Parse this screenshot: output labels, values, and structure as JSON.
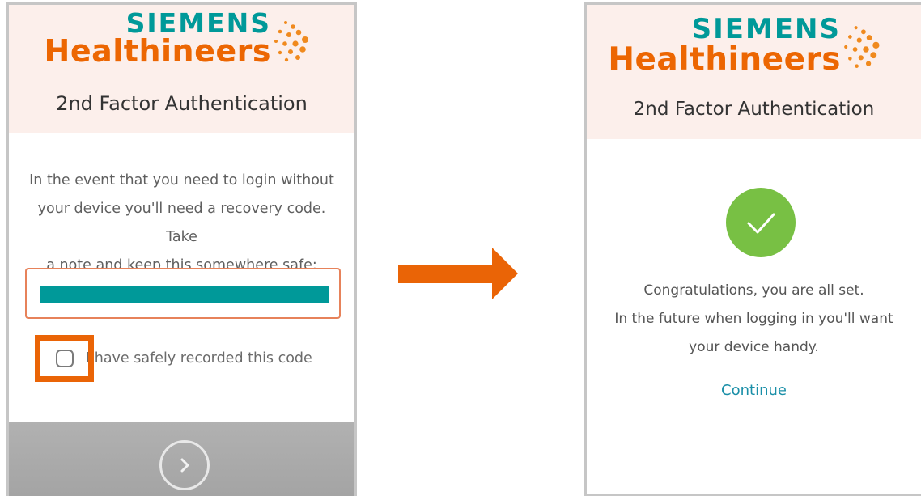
{
  "brand": {
    "line1": "SIEMENS",
    "line2": "Healthineers",
    "colors": {
      "teal": "#009999",
      "orange": "#ec6602",
      "dots": "#f08a1e"
    }
  },
  "left_screen": {
    "header_title": "2nd Factor Authentication",
    "instructions": [
      "In the event that you need to login without",
      "your device you'll need a recovery code. Take",
      "a note and keep this somewhere safe:"
    ],
    "recovery_code_redacted": true,
    "checkbox_label": "I have safely recorded this code",
    "checkbox_checked": false,
    "next_icon": "chevron-right-icon"
  },
  "transition_icon": "arrow-right-icon",
  "right_screen": {
    "header_title": "2nd Factor Authentication",
    "success_icon": "checkmark-icon",
    "message": [
      "Congratulations, you are all set.",
      "In the future when logging in you'll want",
      "your device handy."
    ],
    "continue_link": "Continue"
  }
}
